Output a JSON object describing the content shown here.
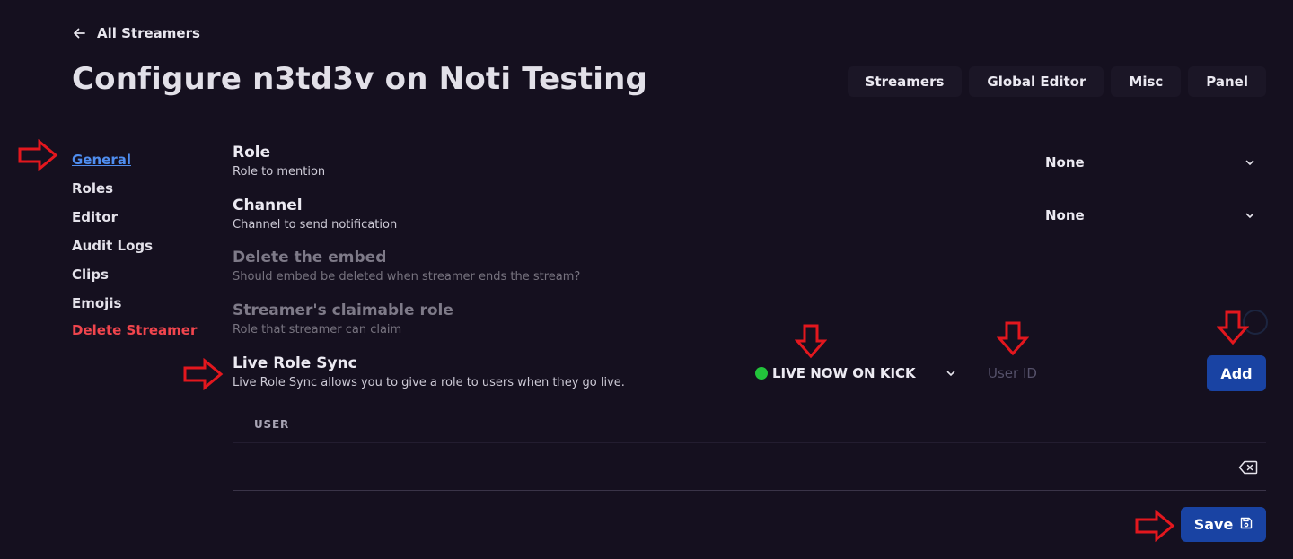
{
  "header": {
    "back_label": "All Streamers",
    "title": "Configure n3td3v on Noti Testing",
    "nav": [
      "Streamers",
      "Global Editor",
      "Misc",
      "Panel"
    ]
  },
  "sidebar": {
    "items": [
      "General",
      "Roles",
      "Editor",
      "Audit Logs",
      "Clips",
      "Emojis"
    ],
    "active": "General",
    "danger_item": "Delete Streamer"
  },
  "settings": {
    "role": {
      "title": "Role",
      "desc": "Role to mention",
      "value": "None"
    },
    "channel": {
      "title": "Channel",
      "desc": "Channel to send notification",
      "value": "None"
    },
    "delete_embed": {
      "title": "Delete the embed",
      "desc": "Should embed be deleted when streamer ends the stream?"
    },
    "claimable_role": {
      "title": "Streamer's claimable role",
      "desc": "Role that streamer can claim"
    },
    "live_role_sync": {
      "title": "Live Role Sync",
      "desc": "Live Role Sync allows you to give a role to users when they go live.",
      "role_value": "LIVE NOW ON KICK",
      "user_id_placeholder": "User ID",
      "add_label": "Add"
    }
  },
  "table": {
    "column_user": "USER"
  },
  "footer": {
    "save_label": "Save"
  },
  "colors": {
    "background": "#15101f",
    "accent": "#1943a3",
    "link": "#4f8ef0",
    "danger": "#f0454d",
    "live_dot": "#22c33b",
    "annotation_arrow": "#e3171e"
  }
}
